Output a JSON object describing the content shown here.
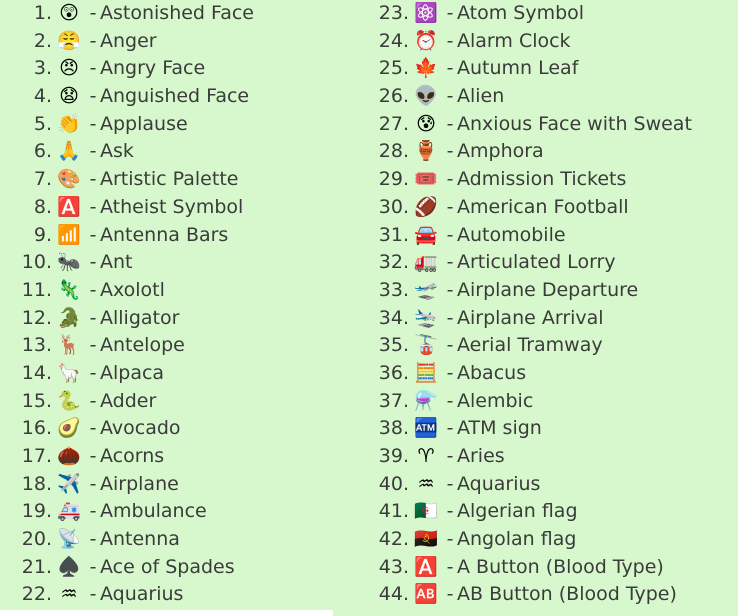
{
  "page": {
    "background_color": "#d6f8cc",
    "text_color": "#3b3b3b",
    "bottom_band_color": "#ffffff",
    "separator": "-"
  },
  "columns": [
    {
      "name": "left-column",
      "items": [
        {
          "number": "1.",
          "emoji": "😲",
          "icon_name": "astonished-face-emoji",
          "label": "Astonished Face"
        },
        {
          "number": "2.",
          "emoji": "😤",
          "icon_name": "anger-emoji",
          "label": "Anger"
        },
        {
          "number": "3.",
          "emoji": "😠",
          "icon_name": "angry-face-emoji",
          "label": "Angry Face"
        },
        {
          "number": "4.",
          "emoji": "😧",
          "icon_name": "anguished-face-emoji",
          "label": "Anguished Face"
        },
        {
          "number": "5.",
          "emoji": "👏",
          "icon_name": "applause-emoji",
          "label": "Applause"
        },
        {
          "number": "6.",
          "emoji": "🙏",
          "icon_name": "ask-folded-hands-emoji",
          "label": "Ask"
        },
        {
          "number": "7.",
          "emoji": "🎨",
          "icon_name": "artistic-palette-emoji",
          "label": "Artistic Palette"
        },
        {
          "number": "8.",
          "emoji": "🅰️",
          "icon_name": "atheist-symbol-emoji",
          "label": "Atheist Symbol"
        },
        {
          "number": "9.",
          "emoji": "📶",
          "icon_name": "antenna-bars-emoji",
          "label": "Antenna Bars"
        },
        {
          "number": "10.",
          "emoji": "🐜",
          "icon_name": "ant-emoji",
          "label": "Ant"
        },
        {
          "number": "11.",
          "emoji": "🦎",
          "icon_name": "axolotl-lizard-emoji",
          "label": "Axolotl"
        },
        {
          "number": "12.",
          "emoji": "🐊",
          "icon_name": "alligator-emoji",
          "label": "Alligator"
        },
        {
          "number": "13.",
          "emoji": "🦌",
          "icon_name": "antelope-deer-emoji",
          "label": "Antelope"
        },
        {
          "number": "14.",
          "emoji": "🦙",
          "icon_name": "alpaca-llama-emoji",
          "label": "Alpaca"
        },
        {
          "number": "15.",
          "emoji": "🐍",
          "icon_name": "adder-snake-emoji",
          "label": "Adder"
        },
        {
          "number": "16.",
          "emoji": "🥑",
          "icon_name": "avocado-emoji",
          "label": "Avocado"
        },
        {
          "number": "17.",
          "emoji": "🌰",
          "icon_name": "acorns-chestnut-emoji",
          "label": "Acorns"
        },
        {
          "number": "18.",
          "emoji": "✈️",
          "icon_name": "airplane-emoji",
          "label": "Airplane"
        },
        {
          "number": "19.",
          "emoji": "🚑",
          "icon_name": "ambulance-emoji",
          "label": "Ambulance"
        },
        {
          "number": "20.",
          "emoji": "📡",
          "icon_name": "antenna-satellite-emoji",
          "label": "Antenna"
        },
        {
          "number": "21.",
          "emoji": "♠️",
          "icon_name": "ace-of-spades-emoji",
          "label": "Ace of Spades"
        },
        {
          "number": "22.",
          "emoji": "♒",
          "icon_name": "aquarius-emoji",
          "label": "Aquarius"
        }
      ]
    },
    {
      "name": "right-column",
      "items": [
        {
          "number": "23.",
          "emoji": "⚛️",
          "icon_name": "atom-symbol-emoji",
          "label": "Atom Symbol"
        },
        {
          "number": "24.",
          "emoji": "⏰",
          "icon_name": "alarm-clock-emoji",
          "label": "Alarm Clock"
        },
        {
          "number": "25.",
          "emoji": "🍁",
          "icon_name": "autumn-leaf-emoji",
          "label": "Autumn Leaf"
        },
        {
          "number": "26.",
          "emoji": "👽",
          "icon_name": "alien-emoji",
          "label": "Alien"
        },
        {
          "number": "27.",
          "emoji": "😰",
          "icon_name": "anxious-face-with-sweat-emoji",
          "label": "Anxious Face with Sweat"
        },
        {
          "number": "28.",
          "emoji": "🏺",
          "icon_name": "amphora-emoji",
          "label": "Amphora"
        },
        {
          "number": "29.",
          "emoji": "🎟️",
          "icon_name": "admission-tickets-emoji",
          "label": "Admission Tickets"
        },
        {
          "number": "30.",
          "emoji": "🏈",
          "icon_name": "american-football-emoji",
          "label": "American Football"
        },
        {
          "number": "31.",
          "emoji": "🚘",
          "icon_name": "automobile-emoji",
          "label": "Automobile"
        },
        {
          "number": "32.",
          "emoji": "🚛",
          "icon_name": "articulated-lorry-emoji",
          "label": "Articulated Lorry"
        },
        {
          "number": "33.",
          "emoji": "🛫",
          "icon_name": "airplane-departure-emoji",
          "label": "Airplane Departure"
        },
        {
          "number": "34.",
          "emoji": "🛬",
          "icon_name": "airplane-arrival-emoji",
          "label": "Airplane Arrival"
        },
        {
          "number": "35.",
          "emoji": "🚡",
          "icon_name": "aerial-tramway-emoji",
          "label": "Aerial Tramway"
        },
        {
          "number": "36.",
          "emoji": "🧮",
          "icon_name": "abacus-emoji",
          "label": "Abacus"
        },
        {
          "number": "37.",
          "emoji": "⚗️",
          "icon_name": "alembic-emoji",
          "label": "Alembic"
        },
        {
          "number": "38.",
          "emoji": "🏧",
          "icon_name": "atm-sign-emoji",
          "label": "ATM sign"
        },
        {
          "number": "39.",
          "emoji": "♈",
          "icon_name": "aries-emoji",
          "label": "Aries"
        },
        {
          "number": "40.",
          "emoji": "♒",
          "icon_name": "aquarius-emoji",
          "label": "Aquarius"
        },
        {
          "number": "41.",
          "emoji": "🇩🇿",
          "icon_name": "algerian-flag-emoji",
          "label": "Algerian flag"
        },
        {
          "number": "42.",
          "emoji": "🇦🇴",
          "icon_name": "angolan-flag-emoji",
          "label": "Angolan flag"
        },
        {
          "number": "43.",
          "emoji": "🅰️",
          "icon_name": "a-button-blood-type-emoji",
          "label": "A Button (Blood Type)"
        },
        {
          "number": "44.",
          "emoji": "🆎",
          "icon_name": "ab-button-blood-type-emoji",
          "label": "AB Button (Blood Type)"
        }
      ]
    }
  ]
}
